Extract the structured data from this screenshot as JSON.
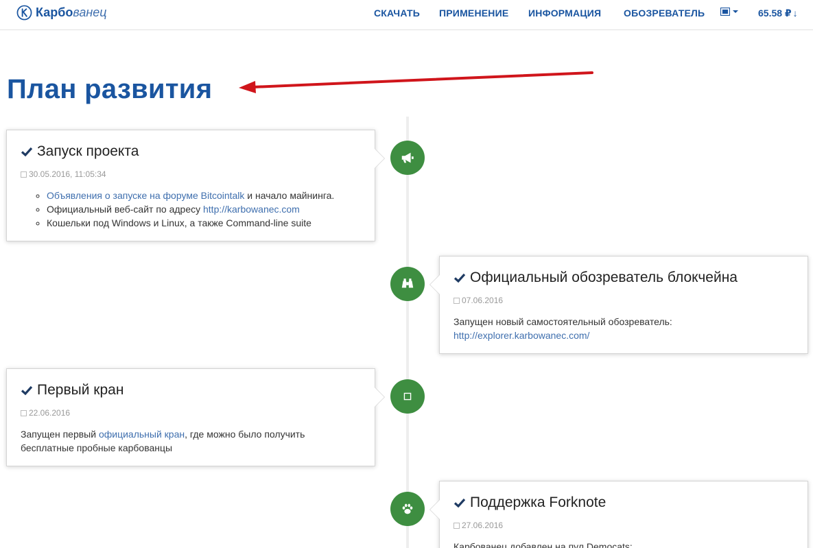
{
  "brand": {
    "bold": "Карбо",
    "italic": "ванец"
  },
  "nav": {
    "download": "СКАЧАТЬ",
    "usage": "ПРИМЕНЕНИЕ",
    "info": "ИНФОРМАЦИЯ",
    "explorer": "ОБОЗРЕВАТЕЛЬ",
    "price": "65.58 ₽",
    "price_arrow": "↓"
  },
  "page": {
    "title": "План развития"
  },
  "colors": {
    "brand": "#1a55a0",
    "link": "#3f6fae",
    "icon_bg": "#3e8e41",
    "annotation_arrow": "#d0151b"
  },
  "timeline": [
    {
      "icon": "megaphone-icon",
      "title": "Запуск проекта",
      "date": "30.05.2016, 11:05:34",
      "bullets": [
        {
          "link": "Объявления о запуске на форуме Bitcointalk",
          "text": " и начало майнинга."
        },
        {
          "text": "Официальный веб-сайт по адресу ",
          "link": "http://karbowanec.com"
        },
        {
          "text": "Кошельки под Windows и Linux, а также Command-line suite"
        }
      ]
    },
    {
      "icon": "binoculars-icon",
      "title": "Официальный обозреватель блокчейна",
      "date": "07.06.2016",
      "text": "Запущен новый самостоятельный обозреватель:",
      "link": "http://explorer.karbowanec.com/"
    },
    {
      "icon": "faucet-icon",
      "title": "Первый кран",
      "date": "22.06.2016",
      "text_before": "Запущен первый ",
      "link": "официальный кран",
      "text_after": ", где можно было получить бесплатные пробные карбованцы"
    },
    {
      "icon": "paw-icon",
      "title": "Поддержка Forknote",
      "date": "27.06.2016",
      "text": "Карбованец добавлен на пул Democats:"
    }
  ]
}
